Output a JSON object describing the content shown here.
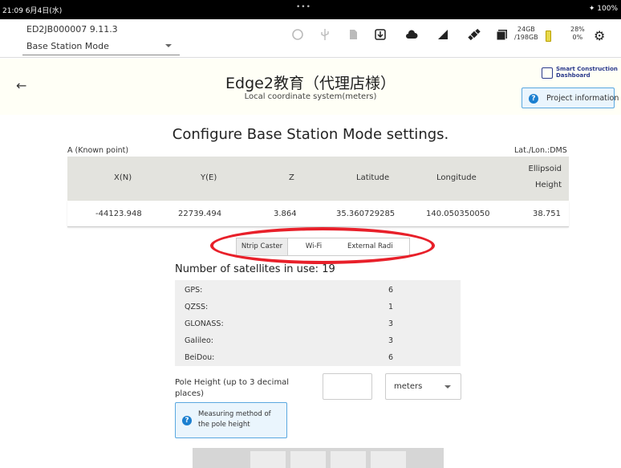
{
  "status_bar": {
    "left": "21:09  6月4日(水)",
    "dots": "•••",
    "right": "✦ 100%"
  },
  "header": {
    "device_id": "ED2JB000007   9.11.3",
    "mode_select": "Base Station Mode",
    "storage": {
      "line1": "24GB",
      "line2": "/198GB"
    },
    "battery": {
      "line1": "28%",
      "line2": "0%"
    },
    "icons": [
      "gps-icon",
      "usb-icon",
      "sd-card-icon",
      "download-icon",
      "cloud-icon",
      "signal-icon",
      "satellite-icon",
      "storage-icon",
      "battery-icon",
      "settings-gear-icon"
    ]
  },
  "project": {
    "title": "Edge2教育（代理店様）",
    "subtitle": "Local coordinate system(meters)",
    "logo_line1": "Smart Construction",
    "logo_line2": "Dashboard",
    "info_button": "Project information"
  },
  "main": {
    "heading": "Configure Base Station Mode settings.",
    "known_point_label": "A (Known point)",
    "latlon_format": "Lat./Lon.:DMS",
    "table": {
      "headers": [
        "X(N)",
        "Y(E)",
        "Z",
        "Latitude",
        "Longitude",
        "Ellipsoid",
        "Height"
      ],
      "values": [
        "-44123.948",
        "22739.494",
        "3.864",
        "35.360729285",
        "140.050350050",
        "38.751"
      ]
    },
    "tabs": [
      "Ntrip Caster",
      "Wi-Fi",
      "External Radi"
    ],
    "active_tab": "Ntrip Caster",
    "annotation_color": "#e8202a",
    "satellites_title": "Number of satellites in use: 19",
    "satellites": [
      {
        "name": "GPS:",
        "count": "6"
      },
      {
        "name": "QZSS:",
        "count": "1"
      },
      {
        "name": "GLONASS:",
        "count": "3"
      },
      {
        "name": "Galileo:",
        "count": "3"
      },
      {
        "name": "BeiDou:",
        "count": "6"
      }
    ],
    "pole_height_label": "Pole Height (up to 3 decimal places)",
    "pole_height_value": "",
    "units": "meters",
    "measure_button": "Measuring method of the pole height"
  },
  "colors": {
    "accent_blue": "#1b7fd0",
    "header_band": "#fffff6",
    "table_header": "#e3e3de"
  }
}
